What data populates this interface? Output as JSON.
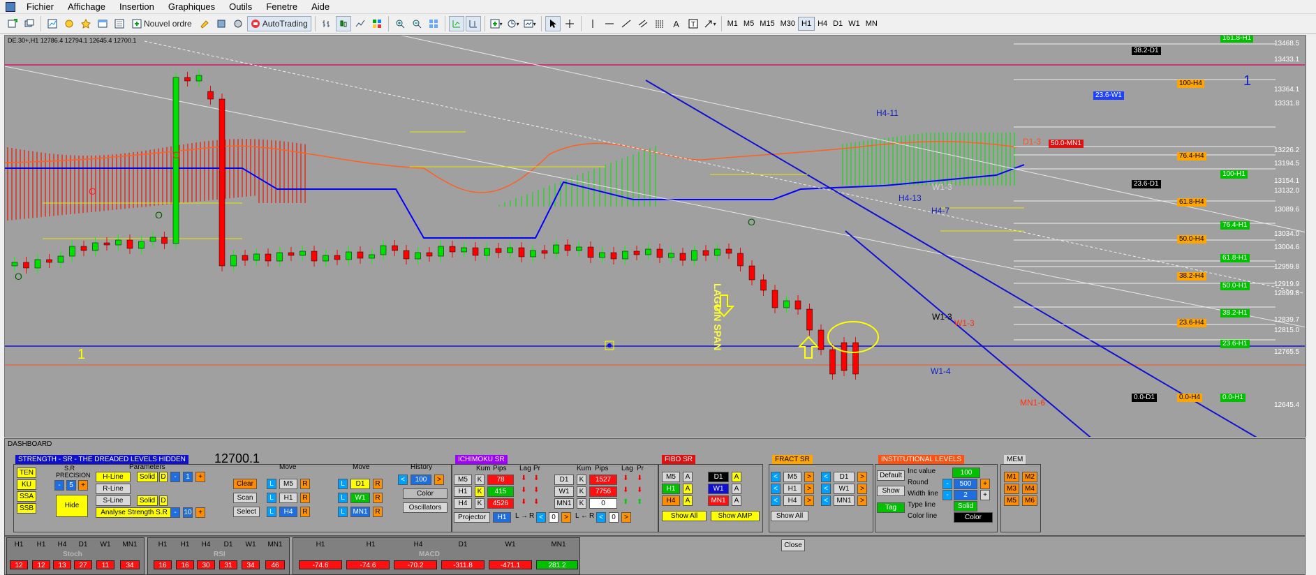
{
  "menu": [
    "Fichier",
    "Affichage",
    "Insertion",
    "Graphiques",
    "Outils",
    "Fenetre",
    "Aide"
  ],
  "toolbar": {
    "new_order": "Nouvel ordre",
    "autotrading": "AutoTrading",
    "timeframes": [
      "M1",
      "M5",
      "M15",
      "M30",
      "H1",
      "H4",
      "D1",
      "W1",
      "MN"
    ],
    "selected_tf": "H1"
  },
  "chart": {
    "symbol_info": "DE.30+,H1  12786.4 12794.1 12645.4 12700.1",
    "price_scale": [
      "13468.5",
      "13433.1",
      "13364.1",
      "13331.8",
      "13226.2",
      "13194.5",
      "13154.1",
      "13132.0",
      "13089.6",
      "13034.0",
      "13004.6",
      "12959.8",
      "12919.9",
      "12899.8",
      "12839.7",
      "12815.0",
      "12765.5",
      "12645.4"
    ],
    "right_labels": [
      {
        "text": "161.8-H1",
        "kind": "green"
      },
      {
        "text": "38.2-D1",
        "kind": "black"
      },
      {
        "text": "100-H4",
        "kind": "orange"
      },
      {
        "text": "23.6-W1",
        "kind": "blue"
      },
      {
        "text": "50.0-MN1",
        "kind": "red"
      },
      {
        "text": "76.4-H4",
        "kind": "orange"
      },
      {
        "text": "100-H1",
        "kind": "green"
      },
      {
        "text": "23.6-D1",
        "kind": "black"
      },
      {
        "text": "61.8-H4",
        "kind": "orange"
      },
      {
        "text": "76.4-H1",
        "kind": "green"
      },
      {
        "text": "50.0-H4",
        "kind": "orange"
      },
      {
        "text": "61.8-H1",
        "kind": "green"
      },
      {
        "text": "38.2-H4",
        "kind": "orange"
      },
      {
        "text": "50.0-H1",
        "kind": "green"
      },
      {
        "text": "38.2-H1",
        "kind": "green"
      },
      {
        "text": "23.6-H4",
        "kind": "orange"
      },
      {
        "text": "23.6-H1",
        "kind": "green"
      },
      {
        "text": "0.0-D1",
        "kind": "black"
      },
      {
        "text": "0.0-H4",
        "kind": "orange"
      },
      {
        "text": "0.0-H1",
        "kind": "green"
      }
    ],
    "annotations": {
      "h4_11": "H4-11",
      "d1_3": "D1-3",
      "w1_3a": "W1-3",
      "h4_13": "H4-13",
      "h4_7": "H4-7",
      "w1_3b": "W1-3",
      "w1_3c": "W1-3",
      "w1_4": "W1-4",
      "mn1_6": "MN1-6",
      "laggin": "LAGGIN SPAN",
      "one_left": "1",
      "one_right": "1"
    }
  },
  "dashboard": {
    "title": "DASHBOARD",
    "price": "12700.1",
    "strength": {
      "title": "STRENGTH - SR - THE DREADED LEVELS HIDDEN",
      "ichimoku_buttons": [
        "TEN",
        "KU",
        "SSA",
        "SSB"
      ],
      "sr": "S.R",
      "precision": "PRECISION",
      "precision_val": "5",
      "hide": "Hide",
      "parameters": "Parameters",
      "lines": [
        "H-Line",
        "R-Line",
        "S-Line"
      ],
      "solid": "Solid",
      "d": "D",
      "minus": "-",
      "plus": "+",
      "hval": "1",
      "analyse": "Analyse Strength S.R",
      "aval": "10",
      "move1": "Move",
      "move2": "Move",
      "history": "History",
      "hist_val": "100",
      "clear": "Clear",
      "scan": "Scan",
      "select": "Select",
      "color": "Color",
      "oscillators": "Oscillators",
      "tf_left": [
        "M5",
        "H1",
        "H4"
      ],
      "tf_right": [
        "D1",
        "W1",
        "MN1"
      ],
      "l": "L",
      "r": "R",
      "lt": "<",
      ">gt": ">"
    },
    "ichimoku": {
      "title": "ICHIMOKU SR",
      "hdr": [
        "Kum",
        "Pips",
        "Lag",
        "Pr"
      ],
      "left": [
        {
          "tf": "M5",
          "k": "K",
          "pips": "78"
        },
        {
          "tf": "H1",
          "k": "K",
          "pips": "415"
        },
        {
          "tf": "H4",
          "k": "K",
          "pips": "4526"
        }
      ],
      "right": [
        {
          "tf": "D1",
          "k": "K",
          "pips": "1527"
        },
        {
          "tf": "W1",
          "k": "K",
          "pips": "7756"
        },
        {
          "tf": "MN1",
          "k": "K",
          "pips": "0"
        }
      ],
      "projector": "Projector",
      "proj_tf": "H1",
      "lr": "L",
      "rr": "R",
      "zero": "0",
      "arrow": "→",
      "larrow": "←"
    },
    "fibo": {
      "title": "FIBO SR",
      "tf": [
        "M5",
        "H1",
        "H4",
        "D1",
        "W1",
        "MN1"
      ],
      "a": "A",
      "show_all": "Show All",
      "show_amp": "Show AMP"
    },
    "fract": {
      "title": "FRACT SR",
      "tf": [
        "M5",
        "H1",
        "H4",
        "D1",
        "W1",
        "MN1"
      ],
      "show_all": "Show All"
    },
    "inst": {
      "title": "INSTITUTIONAL LEVELS",
      "default": "Default",
      "show": "Show",
      "tag": "Tag",
      "inc_label": "Inc value",
      "inc_val": "100",
      "round_label": "Round",
      "round_val": "500",
      "width_label": "Width line",
      "width_val": "2",
      "type_label": "Type line",
      "type_val": "Solid",
      "color_label": "Color line",
      "color_val": "Color"
    },
    "mem": {
      "title": "MEM",
      "items": [
        "M1",
        "M2",
        "M3",
        "M4",
        "M5",
        "M6"
      ]
    },
    "close": "Close"
  },
  "indicators": {
    "stoch": {
      "name": "Stoch",
      "tfs": [
        "H1",
        "H1",
        "H4",
        "D1",
        "W1",
        "MN1"
      ],
      "vals": [
        "12",
        "12",
        "13",
        "27",
        "11",
        "34"
      ]
    },
    "rsi": {
      "name": "RSI",
      "tfs": [
        "H1",
        "H1",
        "H4",
        "D1",
        "W1",
        "MN1"
      ],
      "vals": [
        "16",
        "16",
        "30",
        "31",
        "34",
        "46"
      ]
    },
    "macd": {
      "name": "MACD",
      "tfs": [
        "H1",
        "H1",
        "H4",
        "D1",
        "W1",
        "MN1"
      ],
      "vals": [
        "-74.6",
        "-74.6",
        "-70.2",
        "-311.8",
        "-471.1",
        "281.2"
      ]
    }
  },
  "colors": {
    "bull": "#00ff00",
    "bear": "#ff0000",
    "kumo_bull": "#32cd32",
    "kumo_bear": "#e03020",
    "kijun": "#0000ff",
    "chikou": "#ffff00"
  }
}
